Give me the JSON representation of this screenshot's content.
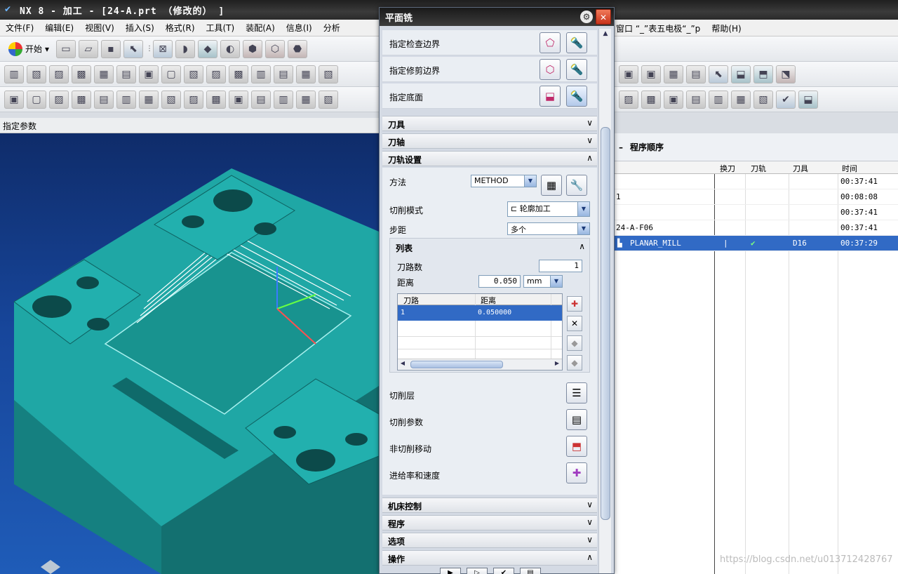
{
  "window": {
    "title": "NX 8 - 加工 - [24-A.prt （修改的） ]"
  },
  "menubar": {
    "items": [
      "文件(F)",
      "编辑(E)",
      "视图(V)",
      "插入(S)",
      "格式(R)",
      "工具(T)",
      "装配(A)",
      "信息(I)",
      "分析"
    ],
    "right_items": [
      "帮助(H)"
    ],
    "right_fragment": "窗口 “_”表五电极“_”p"
  },
  "toolbar": {
    "start_label": "开始"
  },
  "cue_line": "指定参数",
  "dialog": {
    "title": "平面铣",
    "geometry_rows": [
      {
        "label": "指定检查边界"
      },
      {
        "label": "指定修剪边界"
      },
      {
        "label": "指定底面"
      }
    ],
    "sections": {
      "tool": "刀具",
      "axis": "刀轴",
      "path_settings": "刀轨设置",
      "machine_control": "机床控制",
      "program": "程序",
      "options": "选项",
      "actions": "操作"
    },
    "path": {
      "method_label": "方法",
      "method_value": "METHOD",
      "cut_mode_label": "切削模式",
      "cut_mode_value": "轮廓加工",
      "stepover_label": "步距",
      "stepover_value": "多个",
      "list_title": "列表",
      "passes_label": "刀路数",
      "passes_value": "1",
      "distance_label": "距离",
      "distance_value": "0.050",
      "distance_unit": "mm",
      "grid_headers": [
        "刀路",
        "距离"
      ],
      "grid_rows": [
        {
          "pass": "1",
          "distance": "0.050000"
        }
      ],
      "cut_levels_label": "切削层",
      "cut_params_label": "切削参数",
      "non_cut_moves_label": "非切削移动",
      "feeds_speeds_label": "进给率和速度"
    }
  },
  "navigator": {
    "title": "程序顺序",
    "columns": [
      "换刀",
      "刀轨",
      "刀具",
      "时间"
    ],
    "rows": [
      {
        "name": "",
        "tool": "",
        "time": "00:37:41",
        "selected": false
      },
      {
        "name": "1",
        "tool": "",
        "time": "00:08:08",
        "selected": false
      },
      {
        "name": "",
        "tool": "",
        "time": "00:37:41",
        "selected": false
      },
      {
        "name": "24-A-F06",
        "tool": "",
        "time": "00:37:41",
        "selected": false
      },
      {
        "name": "PLANAR_MILL",
        "tool": "D16",
        "time": "00:37:29",
        "selected": true
      }
    ],
    "watermark": "https://blog.csdn.net/u013712428767"
  }
}
